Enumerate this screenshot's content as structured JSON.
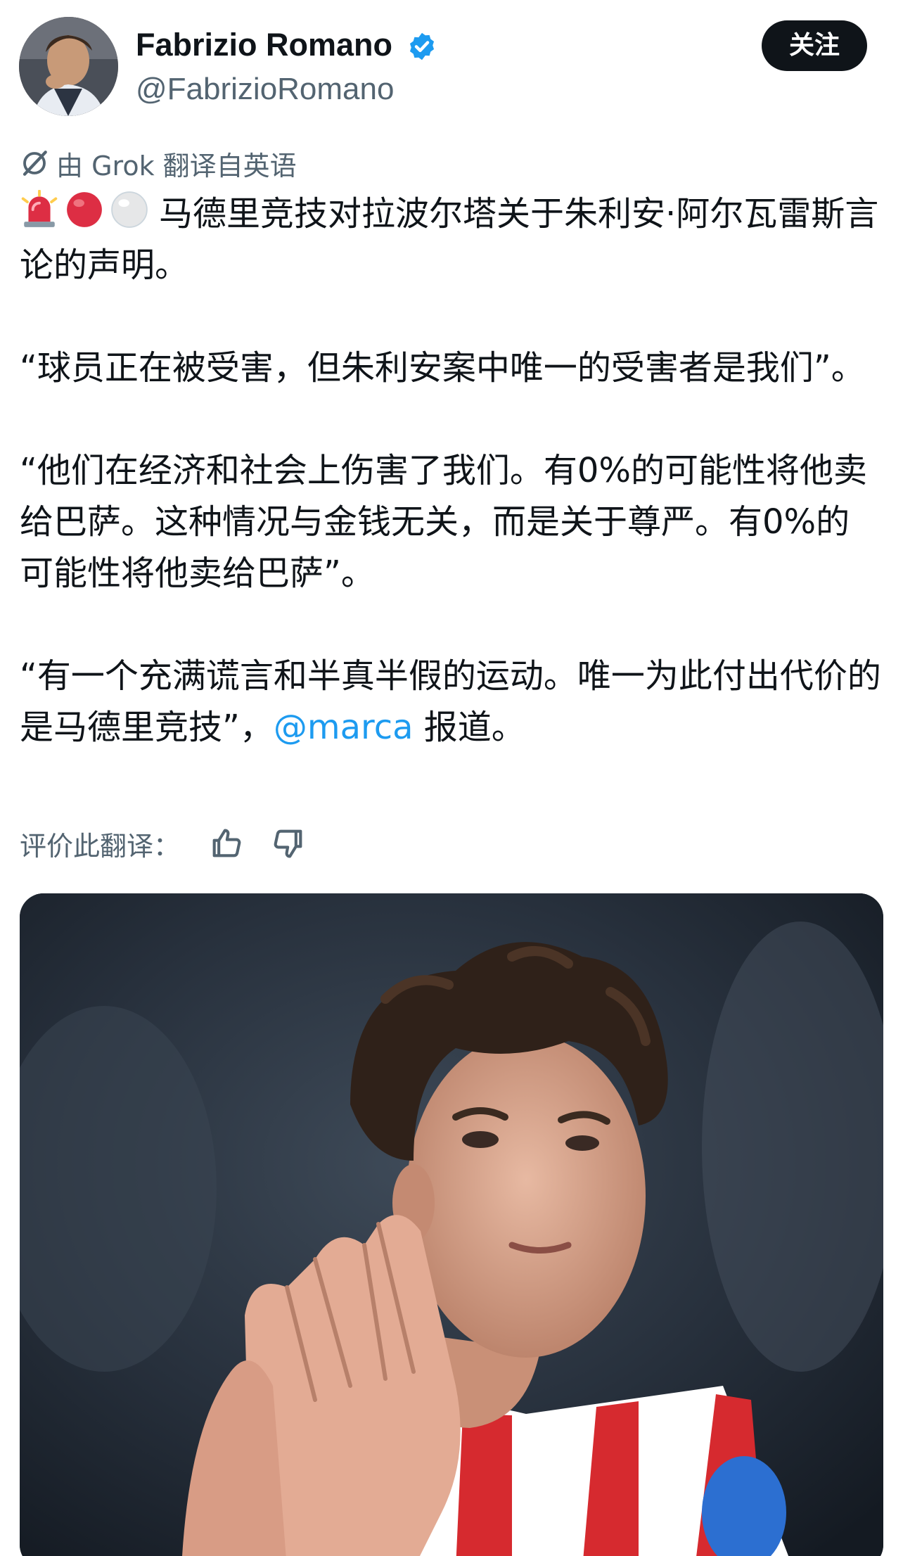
{
  "header": {
    "avatar_icon": "profile-photo",
    "display_name": "Fabrizio Romano",
    "verified_icon": "verified-badge-icon",
    "handle": "@FabrizioRomano",
    "follow_label": "关注"
  },
  "translation": {
    "icon": "grok-icon",
    "label": "由 Grok 翻译自英语"
  },
  "tweet": {
    "emojis": [
      "rotating-light-emoji",
      "red-circle-emoji",
      "white-circle-emoji"
    ],
    "line1": "马德里竞技对拉波尔塔关于朱利安·阿尔瓦雷斯言论的声明。",
    "quote1": "“球员正在被受害，但朱利安案中唯一的受害者是我们”。",
    "quote2": "“他们在经济和社会上伤害了我们。有0%的可能性将他卖给巴萨。这种情况与金钱无关，而是关于尊严。有0%的可能性将他卖给巴萨”。",
    "quote3_text": "“有一个充满谎言和半真半假的运动。唯一为此付出代价的是马德里竞技”，",
    "mention": "@marca",
    "quote3_suffix": " 报道。"
  },
  "rate": {
    "label": "评价此翻译：",
    "like_icon": "thumbs-up-icon",
    "dislike_icon": "thumbs-down-icon"
  },
  "media": {
    "description_icon": "tweet-photo"
  },
  "colors": {
    "text": "#0f1419",
    "secondary": "#536471",
    "link": "#1d9bf0",
    "verified": "#1d9bf0",
    "follow_bg": "#0f1419"
  }
}
